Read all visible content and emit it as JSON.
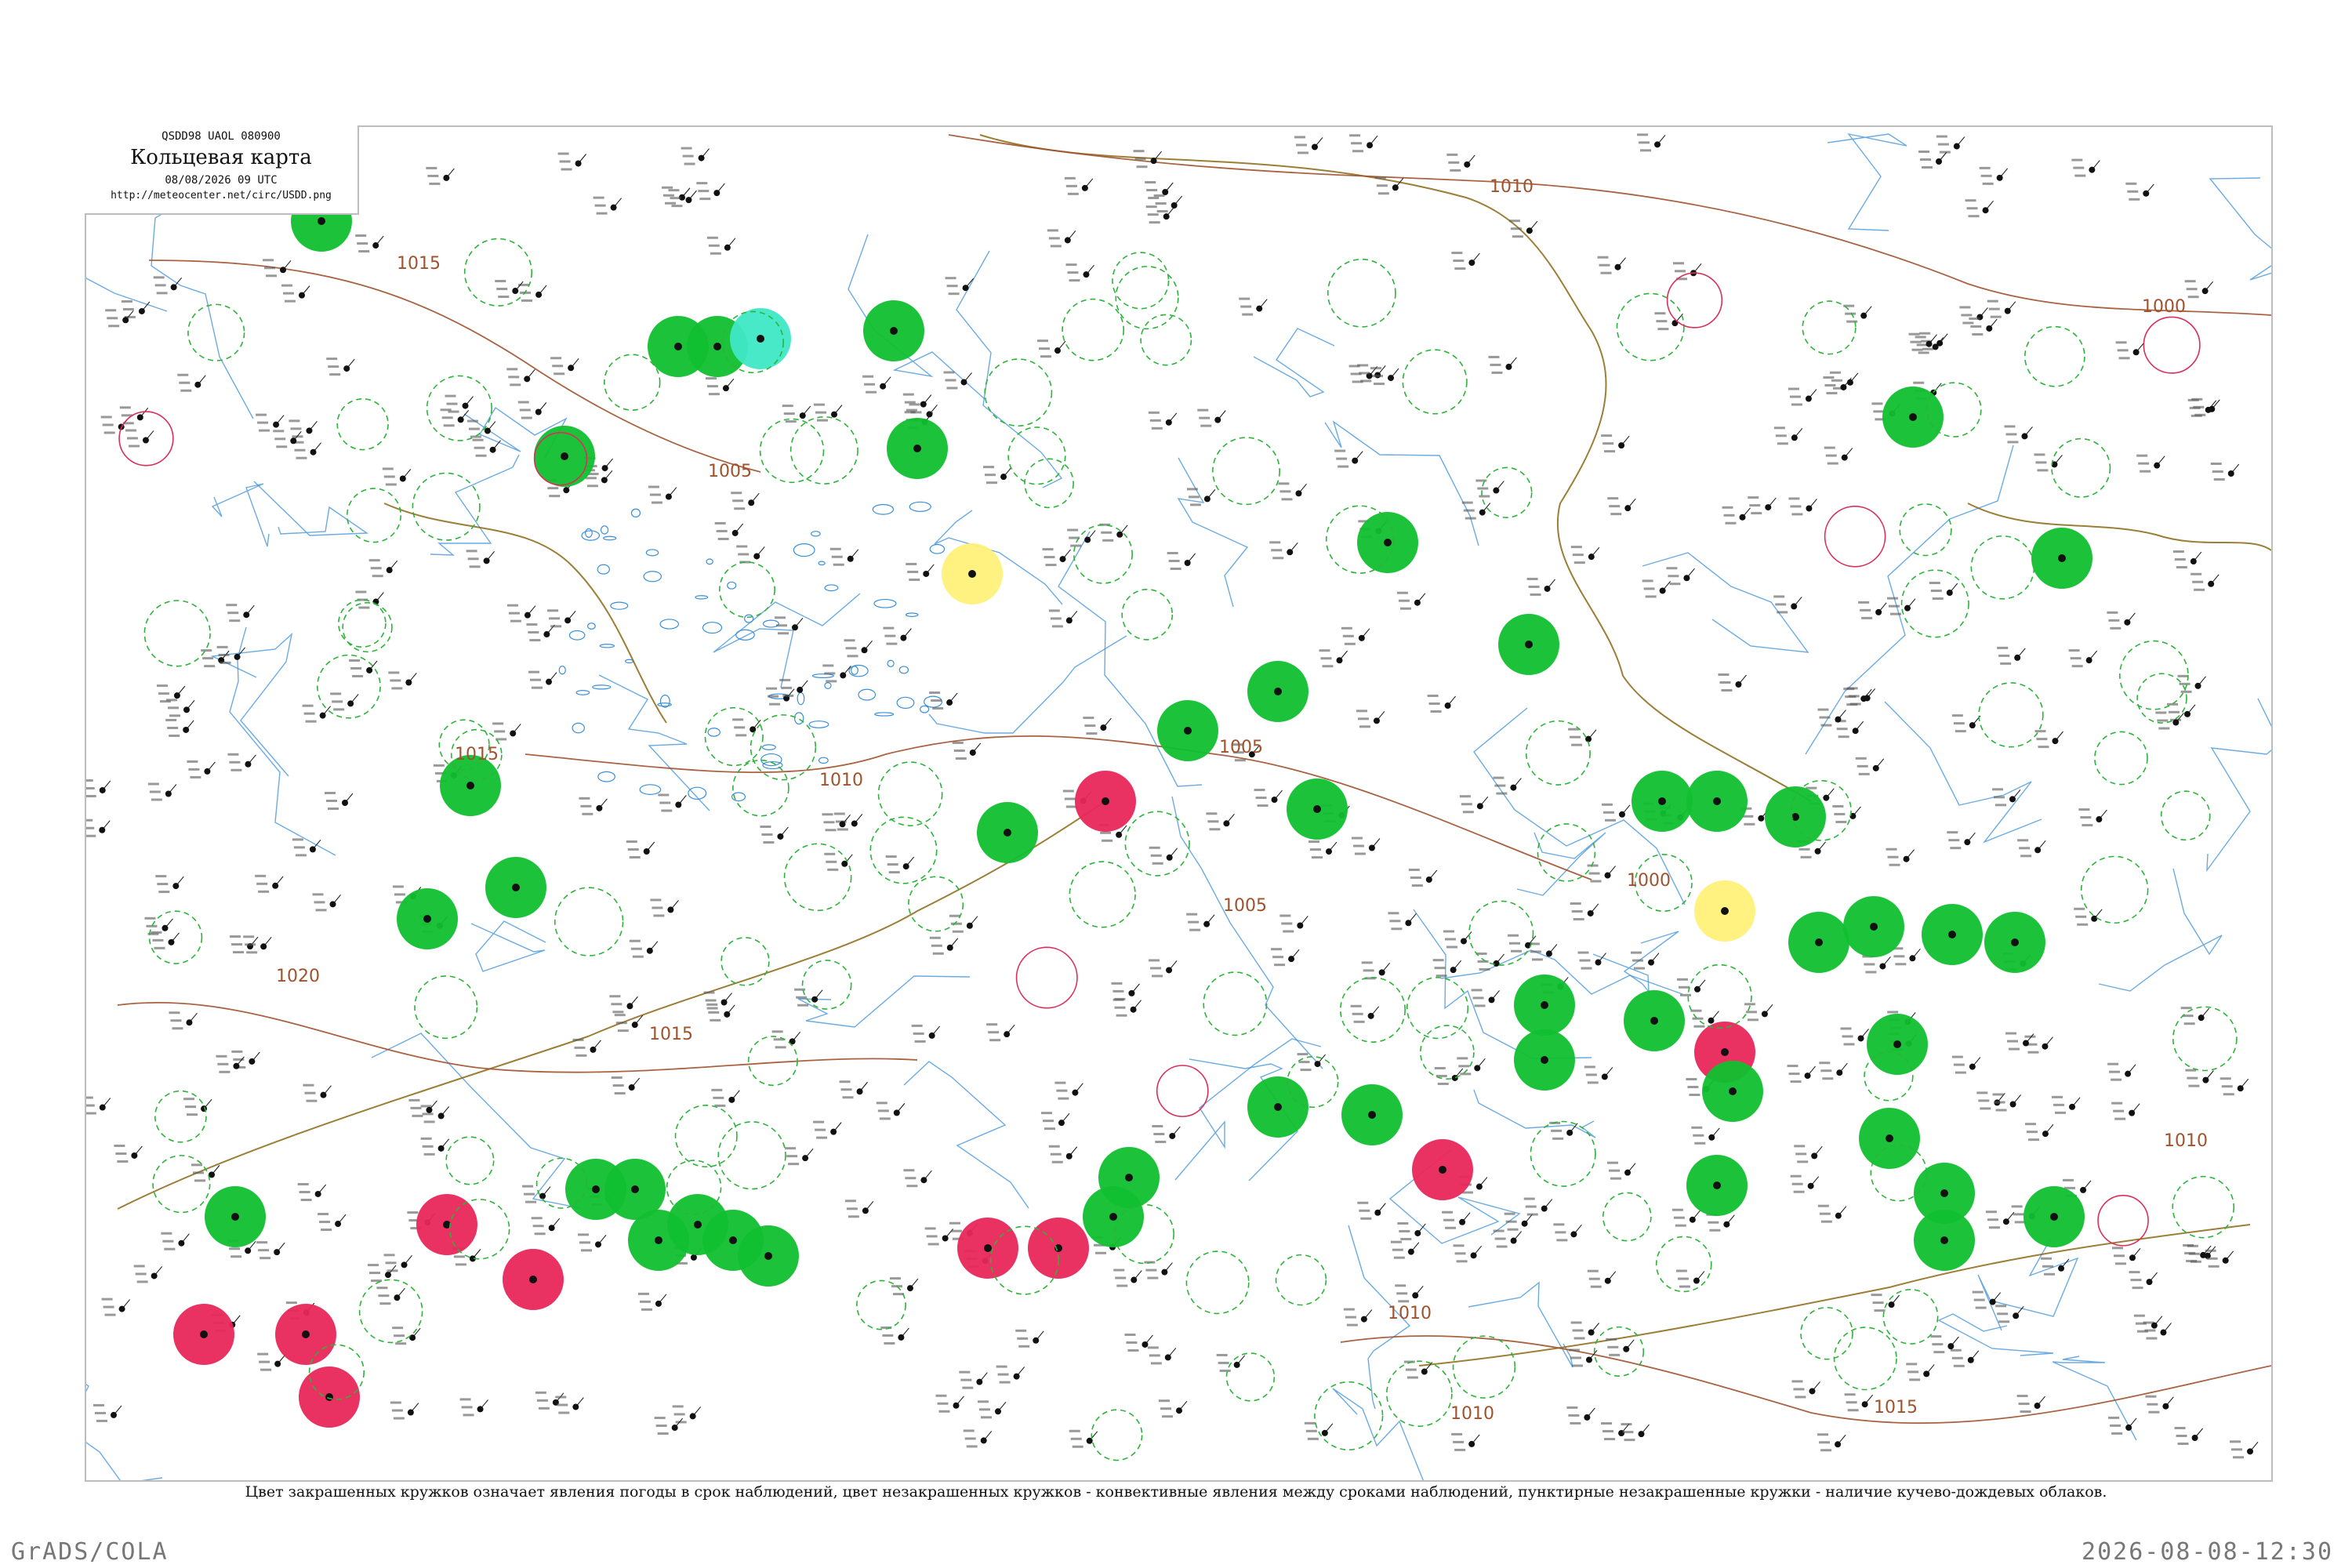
{
  "header": {
    "code": "QSDD98  UAOL  080900",
    "title": "Кольцевая карта",
    "datetime": "08/08/2026 09 UTC",
    "url": "http://meteocenter.net/circ/USDD.png"
  },
  "isobars": [
    "1015",
    "1010",
    "1005",
    "1005",
    "1000",
    "1015",
    "1010",
    "1020",
    "1015",
    "1010",
    "1005",
    "1000",
    "1015",
    "1010",
    "1010"
  ],
  "caption": "Цвет закрашенных кружков означает явления погоды в срок наблюдений, цвет незакрашенных кружков - конвективные явления между сроками наблюдений, пунктирные незакрашенные кружки - наличие кучево-дождевых облаков.",
  "footer": {
    "left": "GrADS/COLA",
    "right": "2026-08-08-12:30"
  },
  "colors": {
    "green_fill": "#10c030",
    "red_fill": "#e8285a",
    "yellow_fill": "#fff27a",
    "cyan_fill": "#3fe8c6",
    "dashed_ring": "#2db33a",
    "red_ring": "#d8305a",
    "isobar": "#a0522d",
    "river": "#3a8fd8",
    "border": "#8b6914"
  },
  "map_legend_markers": {
    "filled_circle": "weather phenomena at observation time",
    "hollow_circle": "convective phenomena between observations",
    "dashed_circle": "cumulonimbus clouds present"
  }
}
